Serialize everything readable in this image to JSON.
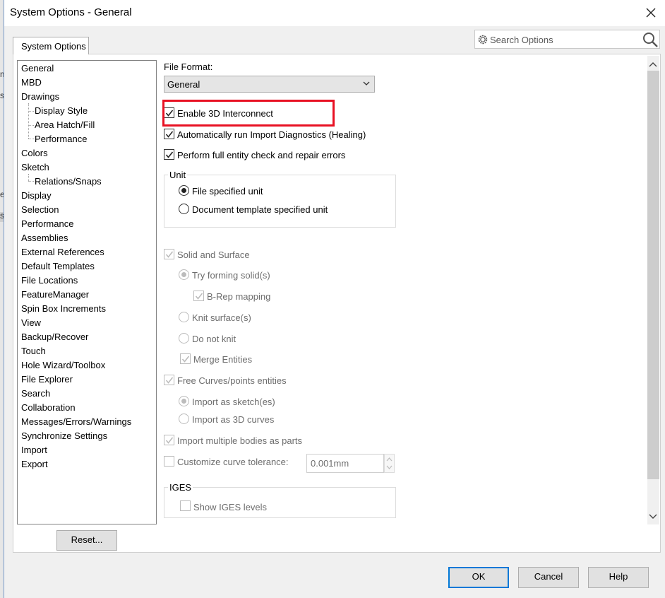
{
  "window": {
    "title": "System Options - General",
    "tab": "System Options"
  },
  "search": {
    "placeholder": "Search Options"
  },
  "tree": {
    "items": [
      "General",
      "MBD",
      "Drawings",
      "Display Style",
      "Area Hatch/Fill",
      "Performance",
      "Colors",
      "Sketch",
      "Relations/Snaps",
      "Display",
      "Selection",
      "Performance",
      "Assemblies",
      "External References",
      "Default Templates",
      "File Locations",
      "FeatureManager",
      "Spin Box Increments",
      "View",
      "Backup/Recover",
      "Touch",
      "Hole Wizard/Toolbox",
      "File Explorer",
      "Search",
      "Collaboration",
      "Messages/Errors/Warnings",
      "Synchronize Settings",
      "Import",
      "Export"
    ]
  },
  "reset_label": "Reset...",
  "file_format": {
    "label": "File Format:",
    "value": "General"
  },
  "options": {
    "enable_3d": {
      "label": "Enable 3D Interconnect",
      "checked": true
    },
    "auto_diag": {
      "label": "Automatically run Import Diagnostics (Healing)",
      "checked": true
    },
    "full_check": {
      "label": "Perform full entity check and repair errors",
      "checked": true
    }
  },
  "unit": {
    "legend": "Unit",
    "file_specified": "File specified unit",
    "doc_template": "Document template specified unit",
    "selected": "file_specified"
  },
  "solid": {
    "label": "Solid and Surface",
    "try_forming": "Try forming solid(s)",
    "brep": "B-Rep mapping",
    "knit": "Knit surface(s)",
    "do_not_knit": "Do not knit",
    "merge": "Merge Entities"
  },
  "curves": {
    "label": "Free Curves/points entities",
    "as_sketch": "Import as sketch(es)",
    "as_3d": "Import as 3D curves"
  },
  "multi_bodies": "Import multiple bodies as parts",
  "tolerance": {
    "label": "Customize curve tolerance:",
    "value": "0.001mm"
  },
  "iges": {
    "legend": "IGES",
    "show_levels": "Show IGES levels"
  },
  "buttons": {
    "ok": "OK",
    "cancel": "Cancel",
    "help": "Help"
  },
  "colors": {
    "highlight": "#e81123",
    "default_button_border": "#0078d7"
  },
  "background_fragments": [
    "m",
    "s",
    "e",
    "s"
  ]
}
